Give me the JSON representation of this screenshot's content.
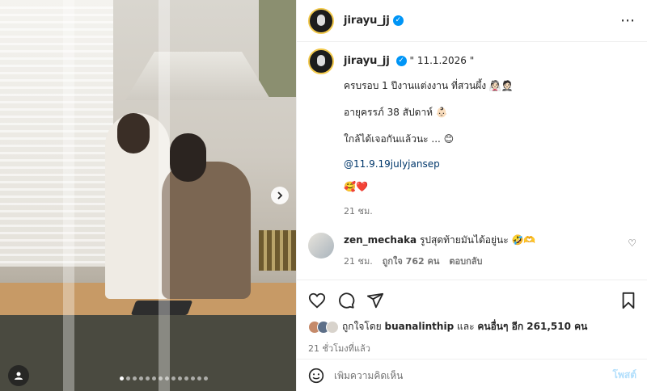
{
  "post": {
    "username": "jirayu_jj",
    "more_icon": "⋯",
    "verified_icon": "✓"
  },
  "caption": {
    "username": "jirayu_jj",
    "date_line": "\" 11.1.2026 \"",
    "line1": "ครบรอบ 1 ปีงานแต่งงาน ที่สวนผึ้ง 👰🏻🤵🏻",
    "line2": "อายุครรภ์ 38 สัปดาห์ 👶🏻",
    "line3": "ใกล้ได้เจอกันแล้วนะ ... 😊",
    "mention": "@11.9.19julyjansep",
    "emojis": "🥰❤️",
    "time": "21 ชม."
  },
  "comment": {
    "username": "zen_mechaka",
    "text": "รูปสุดท้ายมันได้อยู่นะ 🤣🫶",
    "time": "21 ชม.",
    "likes": "ถูกใจ 762 คน",
    "reply": "ตอบกลับ"
  },
  "likes": {
    "prefix": "ถูกใจโดย",
    "user": "buanalinthip",
    "mid": "และ",
    "others": "คนอื่นๆ อีก 261,510 คน"
  },
  "timestamp": "21 ชั่วโมงที่แล้ว",
  "add_comment": {
    "placeholder": "เพิ่มความคิดเห็น",
    "post_label": "โพสต์"
  },
  "carousel": {
    "total": 14,
    "active": 0
  }
}
